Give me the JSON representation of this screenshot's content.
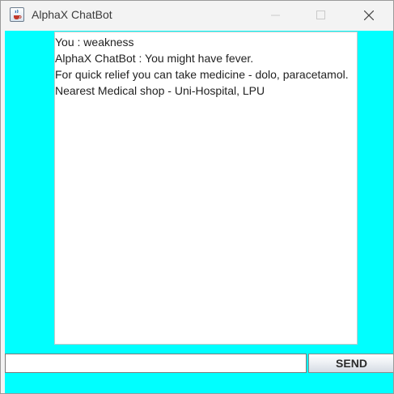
{
  "window": {
    "title": "AlphaX ChatBot",
    "app_icon": "java-cup-icon",
    "controls": [
      "minimize-icon",
      "maximize-icon",
      "close-icon"
    ]
  },
  "colors": {
    "content_background": "#00ffff",
    "chat_background": "#ffffff"
  },
  "chat": {
    "lines": [
      "You : weakness",
      "AlphaX ChatBot : You might have fever.",
      "For quick relief you can take medicine - dolo, paracetamol.",
      "Nearest Medical shop - Uni-Hospital, LPU"
    ]
  },
  "input": {
    "value": "",
    "placeholder": ""
  },
  "send_button": {
    "label": "SEND"
  }
}
